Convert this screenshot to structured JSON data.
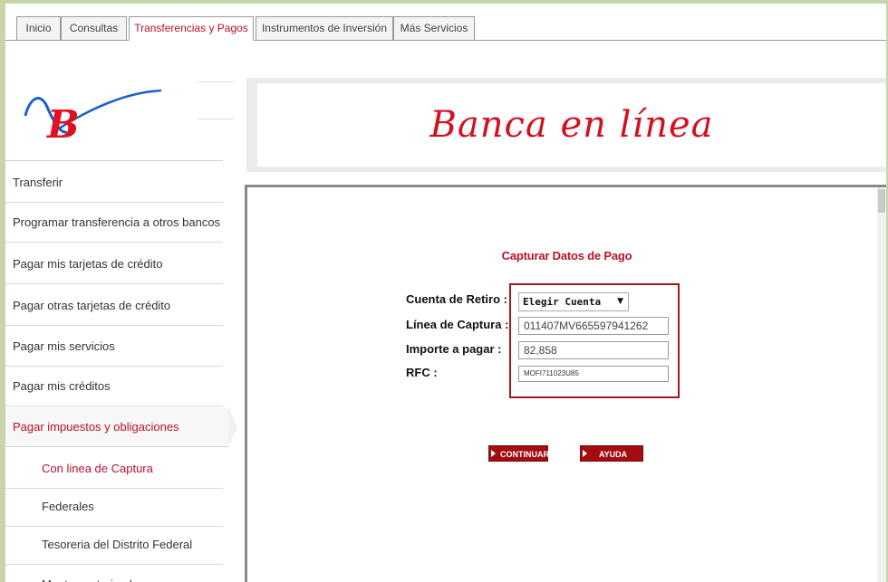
{
  "tabs": [
    {
      "label": "Inicio",
      "active": false
    },
    {
      "label": "Consultas",
      "active": false
    },
    {
      "label": "Transferencias y Pagos",
      "active": true
    },
    {
      "label": "Instrumentos de Inversión",
      "active": false
    },
    {
      "label": "Más Servicios",
      "active": false
    }
  ],
  "banner": {
    "title": "Banca en línea"
  },
  "sidebar": {
    "items": [
      {
        "label": "Transferir"
      },
      {
        "label": "Programar transferencia a otros bancos"
      },
      {
        "label": "Pagar mis tarjetas de crédito"
      },
      {
        "label": "Pagar otras tarjetas de crédito"
      },
      {
        "label": "Pagar mis servicios"
      },
      {
        "label": "Pagar mis créditos"
      },
      {
        "label": "Pagar impuestos y obligaciones",
        "active": true
      }
    ],
    "subitems": [
      {
        "label": "Con linea de Captura",
        "selected": true
      },
      {
        "label": "Federales"
      },
      {
        "label": "Tesoreria del Distrito Federal"
      },
      {
        "label": "Montos autorizados"
      }
    ]
  },
  "form": {
    "title": "Capturar Datos de Pago",
    "cuenta_label": "Cuenta de Retiro :",
    "cuenta_value": "Elegir Cuenta",
    "linea_label": "Línea de Captura :",
    "linea_value": "011407MV665597941262",
    "importe_label": "Importe a pagar :",
    "importe_value": "82,858",
    "rfc_label": "RFC :",
    "rfc_value": "MOFI711023U85"
  },
  "buttons": {
    "continuar": "CONTINUAR",
    "ayuda": "AYUDA"
  },
  "colors": {
    "accent": "#b9112b",
    "button": "#a30d12",
    "page_bg": "#c7d6a9"
  }
}
